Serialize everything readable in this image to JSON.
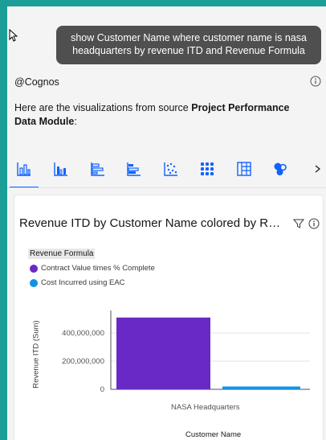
{
  "conversation": {
    "user_message": "show Customer Name where customer name is nasa headquarters by revenue ITD and Revenue Formula",
    "source_mention": "@Cognos",
    "intro_prefix": "Here are the visualizations from source ",
    "intro_source": "Project Performance Data Module",
    "intro_suffix": ":"
  },
  "viz_tabs": [
    {
      "icon": "bar-chart-icon",
      "active": true
    },
    {
      "icon": "clustered-bar-icon",
      "active": false
    },
    {
      "icon": "horizontal-bar-icon",
      "active": false
    },
    {
      "icon": "stacked-horizontal-bar-icon",
      "active": false
    },
    {
      "icon": "scatter-plot-icon",
      "active": false
    },
    {
      "icon": "dot-grid-icon",
      "active": false
    },
    {
      "icon": "table-icon",
      "active": false
    },
    {
      "icon": "bubble-chart-icon",
      "active": false
    }
  ],
  "card": {
    "title": "Revenue ITD by Customer Name colored by R…",
    "legend_title": "Revenue Formula",
    "legend": [
      {
        "label": "Contract Value times % Complete",
        "color": "#6929c4"
      },
      {
        "label": "Cost Incurred using EAC",
        "color": "#1192e8"
      }
    ]
  },
  "chart_data": {
    "type": "bar",
    "categories": [
      "NASA Headquarters"
    ],
    "series": [
      {
        "name": "Contract Value times % Complete",
        "values": [
          510000000
        ],
        "color": "#6929c4"
      },
      {
        "name": "Cost Incurred using EAC",
        "values": [
          20000000
        ],
        "color": "#1192e8"
      }
    ],
    "ylabel": "Revenue ITD (Sum)",
    "xlabel": "Customer Name",
    "yticks": [
      "0",
      "200,000,000",
      "400,000,000"
    ],
    "ylim": [
      0,
      600000000
    ]
  }
}
